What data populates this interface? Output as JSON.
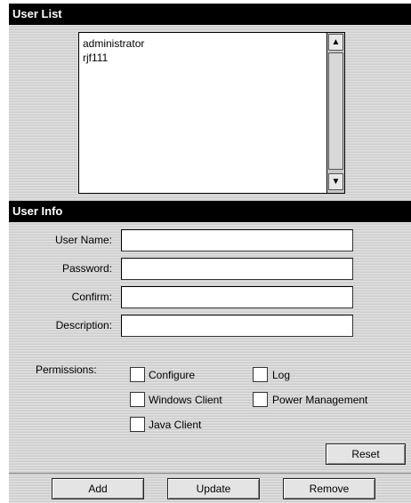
{
  "user_list": {
    "header": "User List",
    "items": [
      "administrator",
      "rjf111"
    ]
  },
  "user_info": {
    "header": "User Info",
    "user_name_label": "User Name:",
    "password_label": "Password:",
    "confirm_label": "Confirm:",
    "description_label": "Description:",
    "user_name_value": "",
    "password_value": "",
    "confirm_value": "",
    "description_value": ""
  },
  "permissions": {
    "label": "Permissions:",
    "configure": "Configure",
    "log": "Log",
    "windows_client": "Windows Client",
    "power_management": "Power Management",
    "java_client": "Java Client"
  },
  "buttons": {
    "reset": "Reset",
    "add": "Add",
    "update": "Update",
    "remove": "Remove"
  }
}
